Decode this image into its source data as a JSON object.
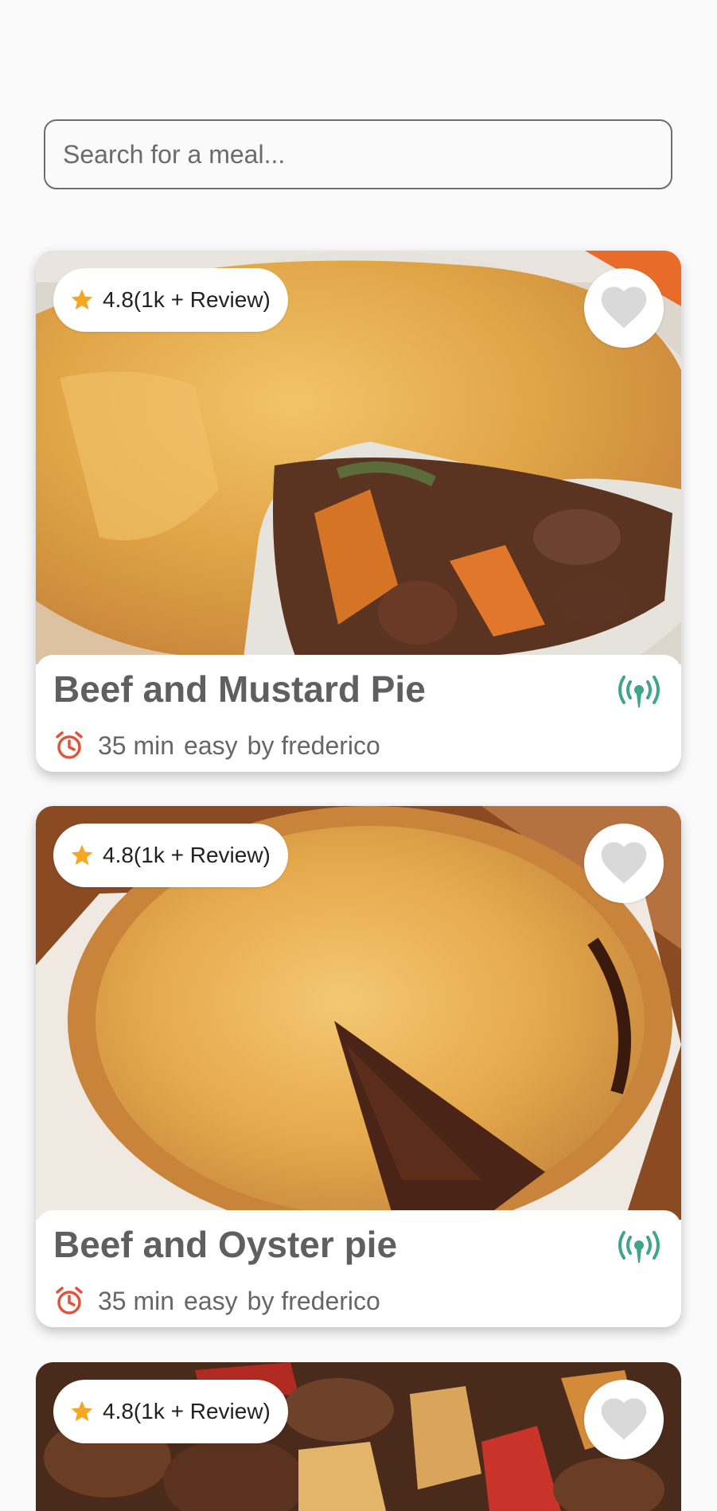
{
  "search": {
    "placeholder": "Search for a meal..."
  },
  "cards": [
    {
      "rating": "4.8(1k + Review)",
      "title": "Beef and Mustard Pie",
      "time": "35 min",
      "difficulty": "easy",
      "author": "by frederico"
    },
    {
      "rating": "4.8(1k + Review)",
      "title": "Beef and Oyster pie",
      "time": "35 min",
      "difficulty": "easy",
      "author": "by frederico"
    },
    {
      "rating": "4.8(1k + Review)"
    }
  ],
  "icons": {
    "star": "star-icon",
    "heart": "heart-icon",
    "broadcast": "broadcast-icon",
    "alarm": "alarm-clock-icon"
  },
  "colors": {
    "star": "#f5a623",
    "heart": "#d9d9d9",
    "broadcast": "#3fa58a",
    "alarm": "#e0553a",
    "title": "#5f5f5f"
  }
}
